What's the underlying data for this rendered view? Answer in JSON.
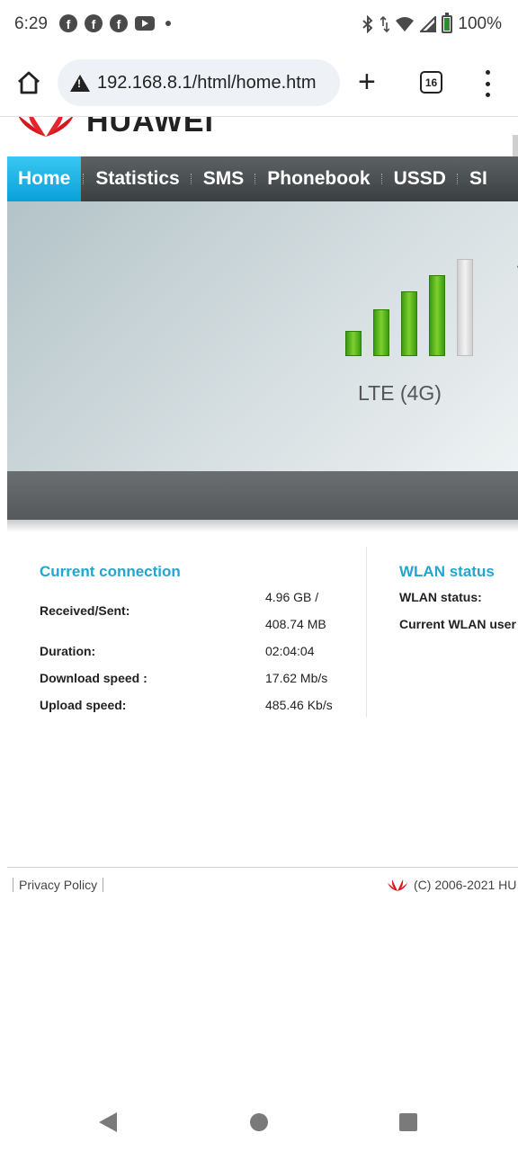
{
  "status_bar": {
    "time": "6:29",
    "battery": "100%"
  },
  "browser": {
    "url": "192.168.8.1/html/home.htm",
    "tab_count": "16"
  },
  "brand": {
    "logo_text": "HUAWEI"
  },
  "nav": {
    "items": [
      "Home",
      "Statistics",
      "SMS",
      "Phonebook",
      "USSD",
      "SI"
    ]
  },
  "signal": {
    "network_type": "LTE (4G)",
    "bars_filled": 4,
    "bars_total": 5
  },
  "current_connection": {
    "title": "Current connection",
    "received_sent_label": "Received/Sent:",
    "received": "4.96 GB /",
    "sent": "408.74 MB",
    "duration_label": "Duration:",
    "duration": "02:04:04",
    "download_label": "Download speed :",
    "download": "17.62 Mb/s",
    "upload_label": "Upload speed:",
    "upload": "485.46 Kb/s"
  },
  "wlan": {
    "title": "WLAN status",
    "status_label": "WLAN status:",
    "users_label": "Current WLAN user"
  },
  "footer": {
    "privacy": "Privacy Policy",
    "copyright": "(C) 2006-2021 HU"
  },
  "cut_text": {
    "letter": "S",
    "line1": "C",
    "line2": "c"
  },
  "colors": {
    "accent": "#22a5cf",
    "active_tab": "#1aaee0",
    "nav_bg": "#4a4e51"
  }
}
